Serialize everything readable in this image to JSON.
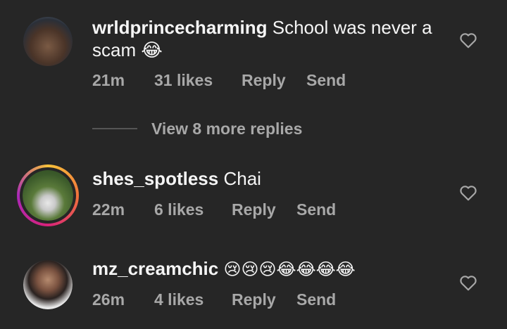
{
  "comments": [
    {
      "username": "wrldprincecharming",
      "text": "School was never a scam 😂",
      "time": "21m",
      "likes": "31 likes",
      "reply_label": "Reply",
      "send_label": "Send"
    },
    {
      "username": "shes_spotless",
      "text": "Chai",
      "time": "22m",
      "likes": "6 likes",
      "reply_label": "Reply",
      "send_label": "Send"
    },
    {
      "username": "mz_creamchic",
      "text": "😢😢😢😂😂😂😂",
      "time": "26m",
      "likes": "4 likes",
      "reply_label": "Reply",
      "send_label": "Send"
    }
  ],
  "view_replies_label": "View 8 more replies",
  "colors": {
    "background": "#262626",
    "text_primary": "#f5f5f5",
    "text_secondary": "#a8a8a8"
  }
}
